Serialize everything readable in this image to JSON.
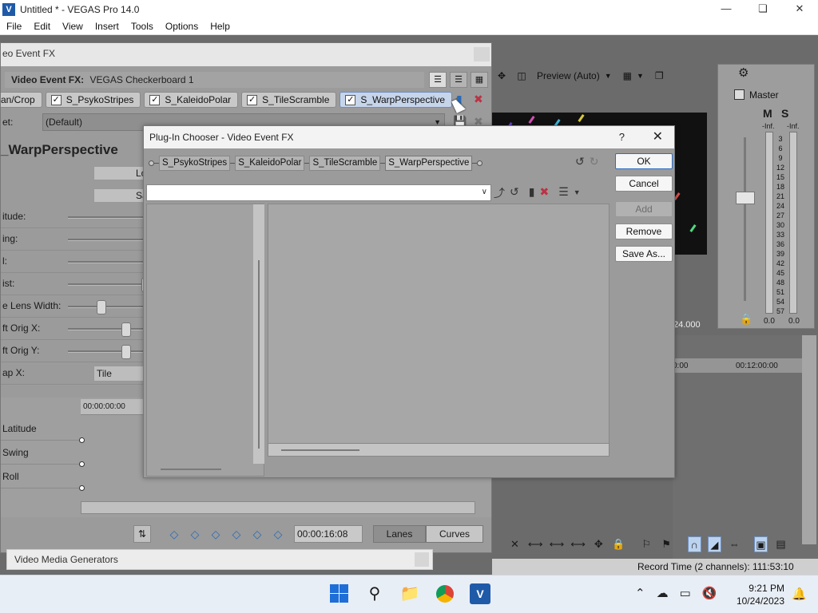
{
  "app": {
    "title": "Untitled * - VEGAS Pro 14.0",
    "logo_text": "V",
    "menu": [
      "File",
      "Edit",
      "View",
      "Insert",
      "Tools",
      "Options",
      "Help"
    ]
  },
  "fx_window": {
    "title": "eo Event FX",
    "header_label": "Video Event FX:",
    "header_value": "VEGAS Checkerboard 1",
    "chain": [
      {
        "label": "an/Crop",
        "checked": true,
        "selected": false
      },
      {
        "label": "S_PsykoStripes",
        "checked": true,
        "selected": false
      },
      {
        "label": "S_KaleidoPolar",
        "checked": true,
        "selected": false
      },
      {
        "label": "S_TileScramble",
        "checked": true,
        "selected": false
      },
      {
        "label": "S_WarpPerspective",
        "checked": true,
        "selected": true
      }
    ],
    "preset_label": "et:",
    "preset_value": "(Default)",
    "plugin_name": "_WarpPerspective",
    "btn_load": "Lo",
    "btn_save": "Sa",
    "params": [
      {
        "label": "itude:"
      },
      {
        "label": "ing:"
      },
      {
        "label": "l:"
      },
      {
        "label": "ist:"
      },
      {
        "label": "e Lens Width:"
      },
      {
        "label": "ft Orig X:"
      },
      {
        "label": "ft Orig Y:"
      },
      {
        "label": "ap X:",
        "value": "Tile"
      }
    ],
    "keyframes": {
      "time_label": "00:00:00:00",
      "rows": [
        "Latitude",
        "Swing",
        "Roll"
      ]
    },
    "timecode": "00:00:16:08",
    "lanes_label": "Lanes",
    "curves_label": "Curves"
  },
  "video_media_generators": "Video Media Generators",
  "preview": {
    "mode": "Preview (Auto)",
    "time_fragment": "24.000"
  },
  "master": {
    "label": "Master",
    "inf_left": "-Inf.",
    "inf_right": "-Inf.",
    "scale": [
      "3",
      "6",
      "9",
      "12",
      "15",
      "18",
      "21",
      "24",
      "27",
      "30",
      "33",
      "36",
      "39",
      "42",
      "45",
      "48",
      "51",
      "54",
      "57"
    ],
    "zero_left": "0.0",
    "zero_right": "0.0"
  },
  "timeline": {
    "ruler": [
      "0:00",
      "00:12:00:00"
    ],
    "status": "Record Time (2 channels): 111:53:10"
  },
  "dialog": {
    "title": "Plug-In Chooser - Video Event FX",
    "help": "?",
    "chain": [
      "S_PsykoStripes",
      "S_KaleidoPolar",
      "S_TileScramble",
      "S_WarpPerspective"
    ],
    "selected_chain": "S_WarpPerspective",
    "dropdown_value": "",
    "buttons": {
      "ok": "OK",
      "cancel": "Cancel",
      "add": "Add",
      "remove": "Remove",
      "save_as": "Save As..."
    }
  },
  "taskbar": {
    "time": "9:21 PM",
    "date": "10/24/2023"
  }
}
